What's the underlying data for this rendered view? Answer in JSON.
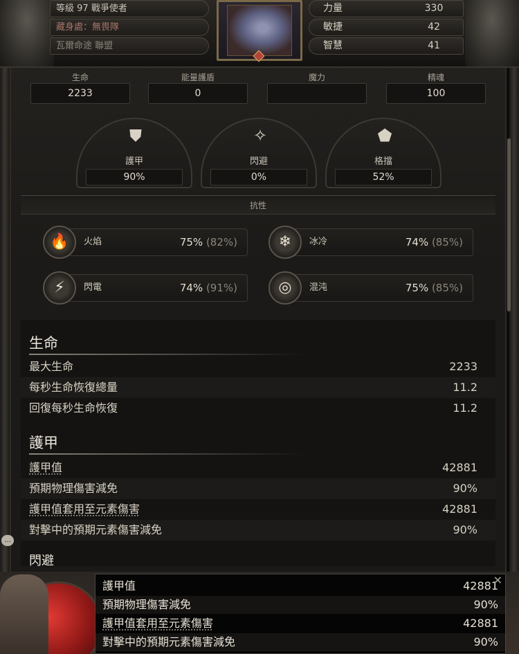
{
  "header": {
    "level_label": "等級",
    "level": "97",
    "class_name": "戰爭使者",
    "hideout_label": "藏身處：",
    "hideout": "無畏隊",
    "faction": "瓦爾命途 聯盟",
    "attributes": [
      {
        "name": "力量",
        "value": "330"
      },
      {
        "name": "敏捷",
        "value": "42"
      },
      {
        "name": "智慧",
        "value": "41"
      }
    ]
  },
  "resources": [
    {
      "label": "生命",
      "value": "2233"
    },
    {
      "label": "能量護盾",
      "value": "0"
    },
    {
      "label": "魔力",
      "value": ""
    },
    {
      "label": "精魂",
      "value": "100"
    }
  ],
  "defences": [
    {
      "label": "護甲",
      "value": "90%",
      "icon": "armour-icon"
    },
    {
      "label": "閃避",
      "value": "0%",
      "icon": "evasion-icon"
    },
    {
      "label": "格擋",
      "value": "52%",
      "icon": "shield-icon"
    }
  ],
  "resistances_title": "抗性",
  "resistances": [
    {
      "name": "火焰",
      "value": "75%",
      "max": "(82%)",
      "icon": "fire-icon",
      "glyph": "🔥"
    },
    {
      "name": "冰冷",
      "value": "74%",
      "max": "(85%)",
      "icon": "cold-icon",
      "glyph": "❄"
    },
    {
      "name": "閃電",
      "value": "74%",
      "max": "(91%)",
      "icon": "lightning-icon",
      "glyph": "⚡"
    },
    {
      "name": "混沌",
      "value": "75%",
      "max": "(85%)",
      "icon": "chaos-icon",
      "glyph": "◎"
    }
  ],
  "life_section": {
    "title": "生命",
    "rows": [
      {
        "label": "最大生命",
        "value": "2233"
      },
      {
        "label": "每秒生命恢復總量",
        "value": "11.2"
      },
      {
        "label": "回復每秒生命恢復",
        "value": "11.2"
      }
    ]
  },
  "armour_section": {
    "title": "護甲",
    "rows": [
      {
        "label": "護甲值",
        "value": "42881"
      },
      {
        "label": "預期物理傷害減免",
        "value": "90%"
      },
      {
        "label": "護甲值套用至元素傷害",
        "value": "42881"
      },
      {
        "label": "對擊中的預期元素傷害減免",
        "value": "90%"
      }
    ]
  },
  "next_section_title": "閃避",
  "tooltip": {
    "close": "✕",
    "rows": [
      {
        "label": "護甲值",
        "value": "42881"
      },
      {
        "label": "預期物理傷害減免",
        "value": "90%"
      },
      {
        "label": "護甲值套用至元素傷害",
        "value": "42881"
      },
      {
        "label": "對擊中的預期元素傷害減免",
        "value": "90%"
      }
    ]
  },
  "colors": {
    "accent": "#ece6da",
    "life_orb": "#c8221e",
    "panel": "#1b1a18"
  }
}
